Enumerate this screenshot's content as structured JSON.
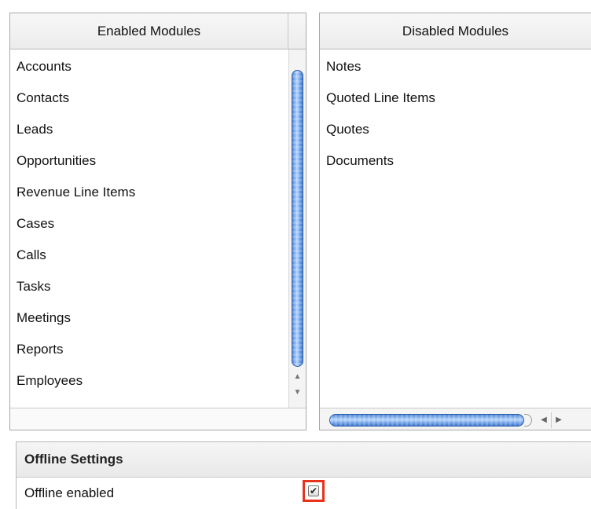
{
  "enabled_panel": {
    "header": "Enabled Modules",
    "items": [
      {
        "label": "Accounts"
      },
      {
        "label": "Contacts"
      },
      {
        "label": "Leads"
      },
      {
        "label": "Opportunities"
      },
      {
        "label": "Revenue Line Items"
      },
      {
        "label": "Cases"
      },
      {
        "label": "Calls"
      },
      {
        "label": "Tasks"
      },
      {
        "label": "Meetings"
      },
      {
        "label": "Reports"
      },
      {
        "label": "Employees"
      }
    ],
    "scroll_up_icon": "triangle-up-icon",
    "scroll_down_icon": "triangle-down-icon"
  },
  "disabled_panel": {
    "header": "Disabled Modules",
    "items": [
      {
        "label": "Notes"
      },
      {
        "label": "Quoted Line Items"
      },
      {
        "label": "Quotes"
      },
      {
        "label": "Documents"
      }
    ],
    "scroll_left_icon": "triangle-left-icon",
    "scroll_right_icon": "triangle-right-icon"
  },
  "offline_settings": {
    "title": "Offline Settings",
    "label": "Offline enabled",
    "checked": true
  },
  "colors": {
    "highlight": "#e8321c",
    "scrollbar_thumb": "#6f9fe6"
  }
}
